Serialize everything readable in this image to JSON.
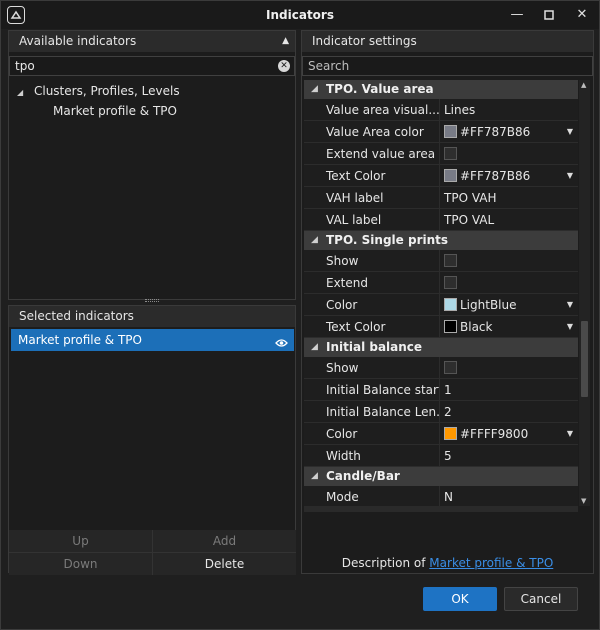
{
  "window": {
    "title": "Indicators"
  },
  "available": {
    "header": "Available indicators",
    "search_value": "tpo",
    "tree": [
      {
        "label": "Clusters, Profiles, Levels",
        "expanded": true
      },
      {
        "label": "Market profile & TPO"
      }
    ]
  },
  "selected": {
    "header": "Selected indicators",
    "items": [
      {
        "label": "Market profile & TPO"
      }
    ],
    "buttons": {
      "up": "Up",
      "add": "Add",
      "down": "Down",
      "delete": "Delete"
    }
  },
  "settings": {
    "header": "Indicator settings",
    "search_placeholder": "Search",
    "categories": [
      {
        "title": "TPO. Value area",
        "rows": [
          {
            "name": "Value area visual...",
            "value": "Lines"
          },
          {
            "name": "Value Area color",
            "value": "#FF787B86",
            "swatch": "#787b86",
            "dropdown": true
          },
          {
            "name": "Extend value area",
            "checkbox": true
          },
          {
            "name": "Text Color",
            "value": "#FF787B86",
            "swatch": "#787b86",
            "dropdown": true
          },
          {
            "name": "VAH label",
            "value": "TPO VAH"
          },
          {
            "name": "VAL label",
            "value": "TPO VAL"
          }
        ]
      },
      {
        "title": "TPO. Single prints",
        "rows": [
          {
            "name": "Show",
            "checkbox": true
          },
          {
            "name": "Extend",
            "checkbox": true
          },
          {
            "name": "Color",
            "value": "LightBlue",
            "swatch": "#add8e6",
            "dropdown": true
          },
          {
            "name": "Text Color",
            "value": "Black",
            "swatch": "#000000",
            "dropdown": true
          }
        ]
      },
      {
        "title": "Initial balance",
        "rows": [
          {
            "name": "Show",
            "checkbox": true
          },
          {
            "name": "Initial Balance start",
            "value": "1"
          },
          {
            "name": "Initial Balance Len...",
            "value": "2"
          },
          {
            "name": "Color",
            "value": "#FFFF9800",
            "swatch": "#ff9800",
            "dropdown": true
          },
          {
            "name": "Width",
            "value": "5"
          }
        ]
      },
      {
        "title": "Candle/Bar",
        "rows": [
          {
            "name": "Mode",
            "value": "N"
          }
        ]
      }
    ],
    "description_prefix": "Description of",
    "description_link": "Market profile & TPO"
  },
  "footer": {
    "ok": "OK",
    "cancel": "Cancel"
  }
}
